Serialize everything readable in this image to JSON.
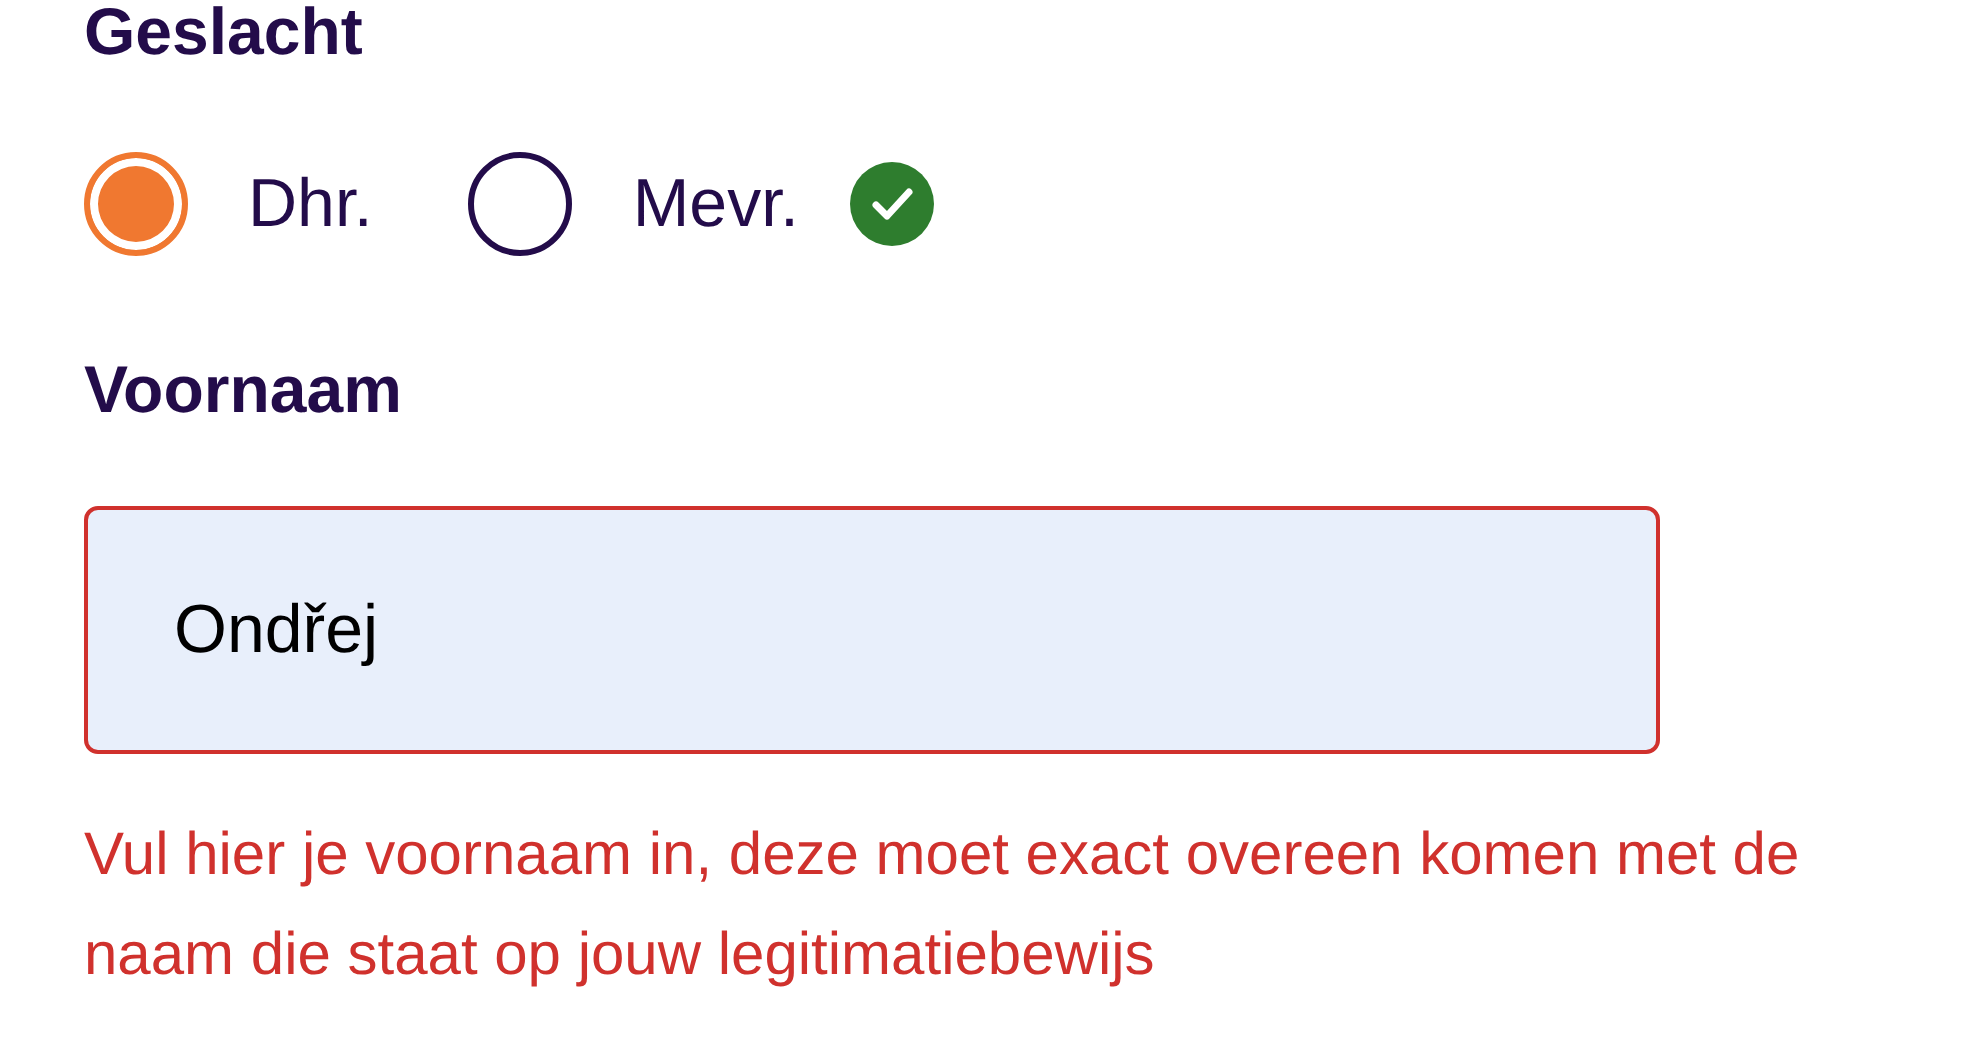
{
  "gender": {
    "label": "Geslacht",
    "options": [
      {
        "label": "Dhr.",
        "selected": true
      },
      {
        "label": "Mevr.",
        "selected": false
      }
    ],
    "valid": true
  },
  "first_name": {
    "label": "Voornaam",
    "value": "Ondřej",
    "error": true,
    "message": "Vul hier je voornaam in, deze moet exact overeen komen met de naam die staat op jouw legitimatiebewijs"
  }
}
